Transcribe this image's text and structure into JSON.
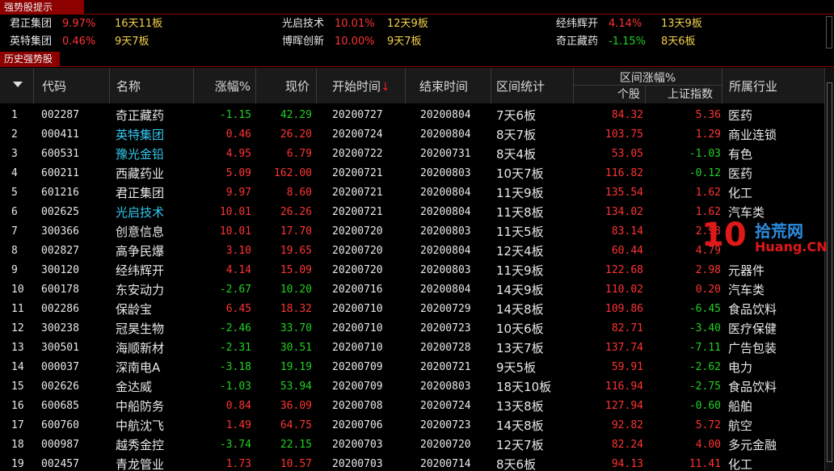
{
  "strong_tab": "强势股提示",
  "history_tab": "历史强势股",
  "summary": [
    [
      {
        "name": "君正集团",
        "pct": "9.97%",
        "dir": "up",
        "boards": "16天11板"
      },
      {
        "name": "英特集团",
        "pct": "0.46%",
        "dir": "up",
        "boards": "9天7板"
      }
    ],
    [
      {
        "name": "光启技术",
        "pct": "10.01%",
        "dir": "up",
        "boards": "12天9板"
      },
      {
        "name": "博晖创新",
        "pct": "10.00%",
        "dir": "up",
        "boards": "9天7板"
      }
    ],
    [
      {
        "name": "经纬辉开",
        "pct": "4.14%",
        "dir": "up",
        "boards": "13天9板"
      },
      {
        "name": "奇正藏药",
        "pct": "-1.15%",
        "dir": "down",
        "boards": "8天6板"
      }
    ]
  ],
  "headers": {
    "code": "代码",
    "name": "名称",
    "pct": "涨幅%",
    "price": "现价",
    "start": "开始时间",
    "sort_arrow": "↓",
    "end": "结束时间",
    "stat": "区间统计",
    "range_gain": "区间涨幅%",
    "stock": "个股",
    "index": "上证指数",
    "industry": "所属行业"
  },
  "rows": [
    {
      "idx": "1",
      "code": "002287",
      "name": "奇正藏药",
      "hl": false,
      "pct": "-1.15",
      "pct_dir": "down",
      "price": "42.29",
      "price_dir": "down",
      "start": "20200727",
      "end": "20200804",
      "stat": "7天6板",
      "gain": "84.32",
      "index": "5.36",
      "index_dir": "up",
      "industry": "医药"
    },
    {
      "idx": "2",
      "code": "000411",
      "name": "英特集团",
      "hl": true,
      "pct": "0.46",
      "pct_dir": "up",
      "price": "26.20",
      "price_dir": "up",
      "start": "20200724",
      "end": "20200804",
      "stat": "8天7板",
      "gain": "103.75",
      "index": "1.29",
      "index_dir": "up",
      "industry": "商业连锁"
    },
    {
      "idx": "3",
      "code": "600531",
      "name": "豫光金铅",
      "hl": true,
      "pct": "4.95",
      "pct_dir": "up",
      "price": "6.79",
      "price_dir": "up",
      "start": "20200722",
      "end": "20200731",
      "stat": "8天4板",
      "gain": "53.05",
      "index": "-1.03",
      "index_dir": "down",
      "industry": "有色"
    },
    {
      "idx": "4",
      "code": "600211",
      "name": "西藏药业",
      "hl": false,
      "pct": "5.09",
      "pct_dir": "up",
      "price": "162.00",
      "price_dir": "up",
      "start": "20200721",
      "end": "20200803",
      "stat": "10天7板",
      "gain": "116.82",
      "index": "-0.12",
      "index_dir": "down",
      "industry": "医药"
    },
    {
      "idx": "5",
      "code": "601216",
      "name": "君正集团",
      "hl": false,
      "pct": "9.97",
      "pct_dir": "up",
      "price": "8.60",
      "price_dir": "up",
      "start": "20200721",
      "end": "20200804",
      "stat": "11天9板",
      "gain": "135.54",
      "index": "1.62",
      "index_dir": "up",
      "industry": "化工"
    },
    {
      "idx": "6",
      "code": "002625",
      "name": "光启技术",
      "hl": true,
      "pct": "10.01",
      "pct_dir": "up",
      "price": "26.26",
      "price_dir": "up",
      "start": "20200721",
      "end": "20200804",
      "stat": "11天8板",
      "gain": "134.02",
      "index": "1.62",
      "index_dir": "up",
      "industry": "汽车类"
    },
    {
      "idx": "7",
      "code": "300366",
      "name": "创意信息",
      "hl": false,
      "pct": "10.01",
      "pct_dir": "up",
      "price": "17.70",
      "price_dir": "up",
      "start": "20200720",
      "end": "20200803",
      "stat": "11天5板",
      "gain": "83.14",
      "index": "2.98",
      "index_dir": "up",
      "industry": ""
    },
    {
      "idx": "8",
      "code": "002827",
      "name": "高争民爆",
      "hl": false,
      "pct": "3.10",
      "pct_dir": "up",
      "price": "19.65",
      "price_dir": "up",
      "start": "20200720",
      "end": "20200804",
      "stat": "12天4板",
      "gain": "60.44",
      "index": "4.79",
      "index_dir": "up",
      "industry": ""
    },
    {
      "idx": "9",
      "code": "300120",
      "name": "经纬辉开",
      "hl": false,
      "pct": "4.14",
      "pct_dir": "up",
      "price": "15.09",
      "price_dir": "up",
      "start": "20200720",
      "end": "20200803",
      "stat": "11天9板",
      "gain": "122.68",
      "index": "2.98",
      "index_dir": "up",
      "industry": "元器件"
    },
    {
      "idx": "10",
      "code": "600178",
      "name": "东安动力",
      "hl": false,
      "pct": "-2.67",
      "pct_dir": "down",
      "price": "10.20",
      "price_dir": "down",
      "start": "20200716",
      "end": "20200804",
      "stat": "14天9板",
      "gain": "110.02",
      "index": "0.20",
      "index_dir": "up",
      "industry": "汽车类"
    },
    {
      "idx": "11",
      "code": "002286",
      "name": "保龄宝",
      "hl": false,
      "pct": "6.45",
      "pct_dir": "up",
      "price": "18.32",
      "price_dir": "up",
      "start": "20200710",
      "end": "20200729",
      "stat": "14天8板",
      "gain": "109.86",
      "index": "-6.45",
      "index_dir": "down",
      "industry": "食品饮料"
    },
    {
      "idx": "12",
      "code": "300238",
      "name": "冠昊生物",
      "hl": false,
      "pct": "-2.46",
      "pct_dir": "down",
      "price": "33.70",
      "price_dir": "down",
      "start": "20200710",
      "end": "20200723",
      "stat": "10天6板",
      "gain": "82.71",
      "index": "-3.40",
      "index_dir": "down",
      "industry": "医疗保健"
    },
    {
      "idx": "13",
      "code": "300501",
      "name": "海顺新材",
      "hl": false,
      "pct": "-2.31",
      "pct_dir": "down",
      "price": "30.51",
      "price_dir": "down",
      "start": "20200710",
      "end": "20200728",
      "stat": "13天7板",
      "gain": "137.74",
      "index": "-7.11",
      "index_dir": "down",
      "industry": "广告包装"
    },
    {
      "idx": "14",
      "code": "000037",
      "name": "深南电A",
      "hl": false,
      "pct": "-3.18",
      "pct_dir": "down",
      "price": "19.19",
      "price_dir": "down",
      "start": "20200709",
      "end": "20200721",
      "stat": "9天5板",
      "gain": "59.91",
      "index": "-2.62",
      "index_dir": "down",
      "industry": "电力"
    },
    {
      "idx": "15",
      "code": "002626",
      "name": "金达威",
      "hl": false,
      "pct": "-1.03",
      "pct_dir": "down",
      "price": "53.94",
      "price_dir": "down",
      "start": "20200709",
      "end": "20200803",
      "stat": "18天10板",
      "gain": "116.94",
      "index": "-2.75",
      "index_dir": "down",
      "industry": "食品饮料"
    },
    {
      "idx": "16",
      "code": "600685",
      "name": "中船防务",
      "hl": false,
      "pct": "0.84",
      "pct_dir": "up",
      "price": "36.09",
      "price_dir": "up",
      "start": "20200708",
      "end": "20200724",
      "stat": "13天8板",
      "gain": "127.94",
      "index": "-0.60",
      "index_dir": "down",
      "industry": "船舶"
    },
    {
      "idx": "17",
      "code": "600760",
      "name": "中航沈飞",
      "hl": false,
      "pct": "1.49",
      "pct_dir": "up",
      "price": "64.75",
      "price_dir": "up",
      "start": "20200706",
      "end": "20200723",
      "stat": "14天8板",
      "gain": "92.82",
      "index": "5.72",
      "index_dir": "up",
      "industry": "航空"
    },
    {
      "idx": "18",
      "code": "000987",
      "name": "越秀金控",
      "hl": false,
      "pct": "-3.74",
      "pct_dir": "down",
      "price": "22.15",
      "price_dir": "down",
      "start": "20200703",
      "end": "20200720",
      "stat": "12天7板",
      "gain": "82.24",
      "index": "4.00",
      "index_dir": "up",
      "industry": "多元金融"
    },
    {
      "idx": "19",
      "code": "002457",
      "name": "青龙管业",
      "hl": false,
      "pct": "1.73",
      "pct_dir": "up",
      "price": "10.57",
      "price_dir": "up",
      "start": "20200703",
      "end": "20200714",
      "stat": "8天6板",
      "gain": "94.13",
      "index": "11.41",
      "index_dir": "up",
      "industry": "化工"
    }
  ],
  "watermark": {
    "num": "10",
    "cn": "拾荒网",
    "en": "Huang.CN"
  },
  "colors": {
    "up": "#ff3333",
    "down": "#22d022",
    "highlight_name": "#33c8f0",
    "tab": "#8c0000",
    "boards": "#f2d04a"
  }
}
